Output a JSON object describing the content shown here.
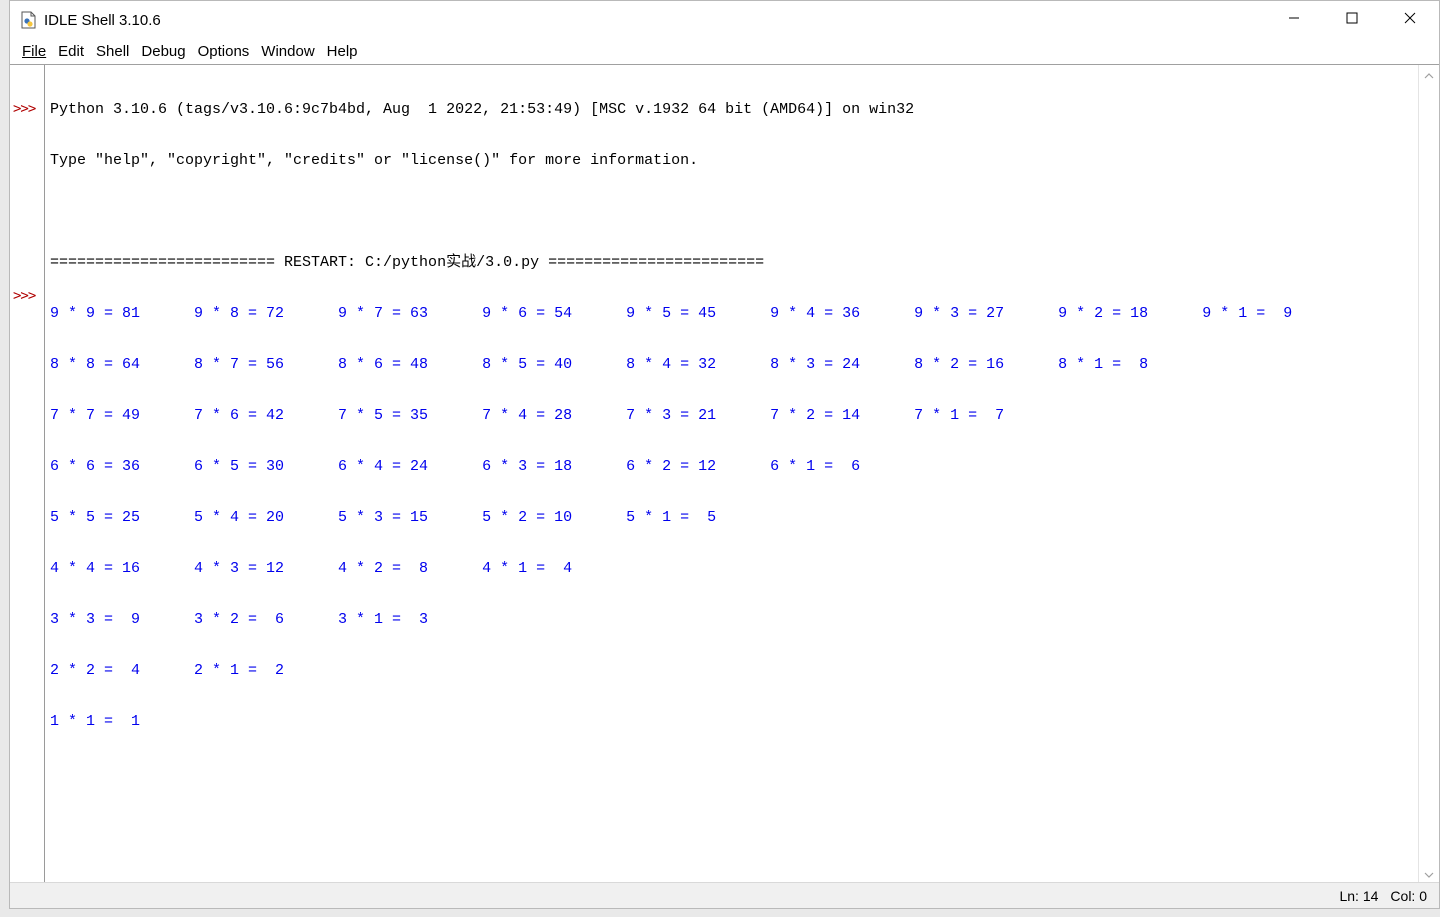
{
  "window": {
    "title": "IDLE Shell 3.10.6"
  },
  "menu": [
    {
      "label": "File"
    },
    {
      "label": "Edit"
    },
    {
      "label": "Shell"
    },
    {
      "label": "Debug"
    },
    {
      "label": "Options"
    },
    {
      "label": "Window"
    },
    {
      "label": "Help"
    }
  ],
  "gutter": {
    "prompt_1": ">>>",
    "prompt_2": ">>>"
  },
  "shell": {
    "banner_line_1": "Python 3.10.6 (tags/v3.10.6:9c7b4bd, Aug  1 2022, 21:53:49) [MSC v.1932 64 bit (AMD64)] on win32",
    "banner_line_2": "Type \"help\", \"copyright\", \"credits\" or \"license()\" for more information.",
    "restart_line": "========================= RESTART: C:/python实战/3.0.py ========================",
    "output_lines": [
      "9 * 9 = 81      9 * 8 = 72      9 * 7 = 63      9 * 6 = 54      9 * 5 = 45      9 * 4 = 36      9 * 3 = 27      9 * 2 = 18      9 * 1 =  9",
      "8 * 8 = 64      8 * 7 = 56      8 * 6 = 48      8 * 5 = 40      8 * 4 = 32      8 * 3 = 24      8 * 2 = 16      8 * 1 =  8",
      "7 * 7 = 49      7 * 6 = 42      7 * 5 = 35      7 * 4 = 28      7 * 3 = 21      7 * 2 = 14      7 * 1 =  7",
      "6 * 6 = 36      6 * 5 = 30      6 * 4 = 24      6 * 3 = 18      6 * 2 = 12      6 * 1 =  6",
      "5 * 5 = 25      5 * 4 = 20      5 * 3 = 15      5 * 2 = 10      5 * 1 =  5",
      "4 * 4 = 16      4 * 3 = 12      4 * 2 =  8      4 * 1 =  4",
      "3 * 3 =  9      3 * 2 =  6      3 * 1 =  3",
      "2 * 2 =  4      2 * 1 =  2",
      "1 * 1 =  1"
    ]
  },
  "status": {
    "line": "Ln: 14",
    "col": "Col: 0"
  },
  "colors": {
    "output_text": "#0000ee",
    "prompt": "#b00000",
    "banner_text": "#000000"
  },
  "icons": {
    "app": "python-idle-icon",
    "minimize": "minimize-icon",
    "maximize": "maximize-icon",
    "close": "close-icon",
    "scroll_up": "scroll-up-icon",
    "scroll_down": "scroll-down-icon"
  }
}
